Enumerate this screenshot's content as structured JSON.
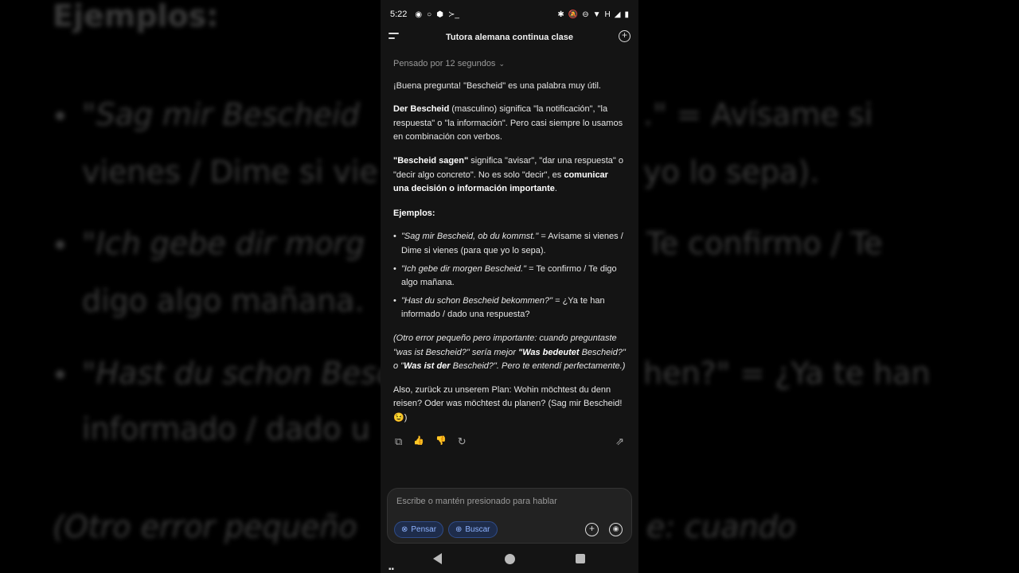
{
  "background": {
    "heading": "Ejemplos:",
    "lines": [
      {
        "text": "\"Sag mir Bescheid",
        "italic": true
      },
      {
        "text": ".\" = Avísame si",
        "italic": false
      },
      {
        "text": "vienes / Dime si vie",
        "italic": false
      },
      {
        "text": "yo lo sepa).",
        "italic": false
      },
      {
        "text": "\"Ich gebe dir morg",
        "italic": true
      },
      {
        "text": "Te confirmo / Te",
        "italic": false
      },
      {
        "text": "digo algo mañana.",
        "italic": false
      },
      {
        "text": "\"Hast du schon Besc",
        "italic": true
      },
      {
        "text": "hen?\" = ¿Ya te han",
        "italic": false
      },
      {
        "text": "informado / dado u",
        "italic": false
      },
      {
        "text": "(Otro error pequeño",
        "italic": true
      },
      {
        "text": "e: cuando",
        "italic": true
      }
    ]
  },
  "status_bar": {
    "time": "5:22",
    "left_icons": [
      "◉",
      "○",
      "⬢",
      "≻_"
    ],
    "right_icons": [
      "✱",
      "🔕",
      "⊖",
      "▼",
      "H",
      "◢",
      "▮"
    ]
  },
  "top_bar": {
    "menu_icon": "menu-icon",
    "title": "Tutora alemana continua clase",
    "new_chat_icon": "+"
  },
  "message": {
    "thought": "Pensado por 12 segundos",
    "thought_chevron": "⌄",
    "intro": "¡Buena pregunta! \"Bescheid\" es una palabra muy útil.",
    "p1_bold": "Der Bescheid",
    "p1_rest": " (masculino) significa \"la notificación\", \"la respuesta\" o \"la información\". Pero casi siempre lo usamos en combinación con verbos.",
    "p2_bold": "\"Bescheid sagen\"",
    "p2_mid": " significa \"avisar\", \"dar una respuesta\" o \"decir algo concreto\". No es solo \"decir\", es ",
    "p2_bold2": "comunicar una decisión o información importante",
    "p2_end": ".",
    "examples_heading": "Ejemplos:",
    "examples": [
      {
        "de": "\"Sag mir Bescheid, ob du kommst.\"",
        "es": " = Avísame si vienes / Dime si vienes (para que yo lo sepa)."
      },
      {
        "de": "\"Ich gebe dir morgen Bescheid.\"",
        "es": " = Te confirmo / Te digo algo mañana."
      },
      {
        "de": "\"Hast du schon Bescheid bekommen?\"",
        "es": " = ¿Ya te han informado / dado una respuesta?"
      }
    ],
    "note_a": "(Otro error pequeño pero importante: cuando preguntaste \"was ist Bescheid?\" sería mejor ",
    "note_b1": "\"Was bedeutet",
    "note_c": " Bescheid?\" o \"",
    "note_b2": "Was ist der",
    "note_d": " Bescheid?\". Pero te entendí perfectamente.)",
    "closing": "Also, zurück zu unserem Plan: Wohin möchtest du denn reisen? Oder was möchtest du planen? (Sag mir Bescheid! 😉)"
  },
  "actions": {
    "copy": "⧉",
    "like": "👍",
    "dislike": "👎",
    "regenerate": "↻",
    "share": "⇗"
  },
  "composer": {
    "placeholder": "Escribe o mantén presionado para hablar",
    "think_label": "Pensar",
    "think_icon": "⊗",
    "search_label": "Buscar",
    "search_icon": "⊕",
    "plus_icon": "+",
    "voice_icon": "◉"
  },
  "nav": {
    "grid_icon": "▪▪"
  }
}
